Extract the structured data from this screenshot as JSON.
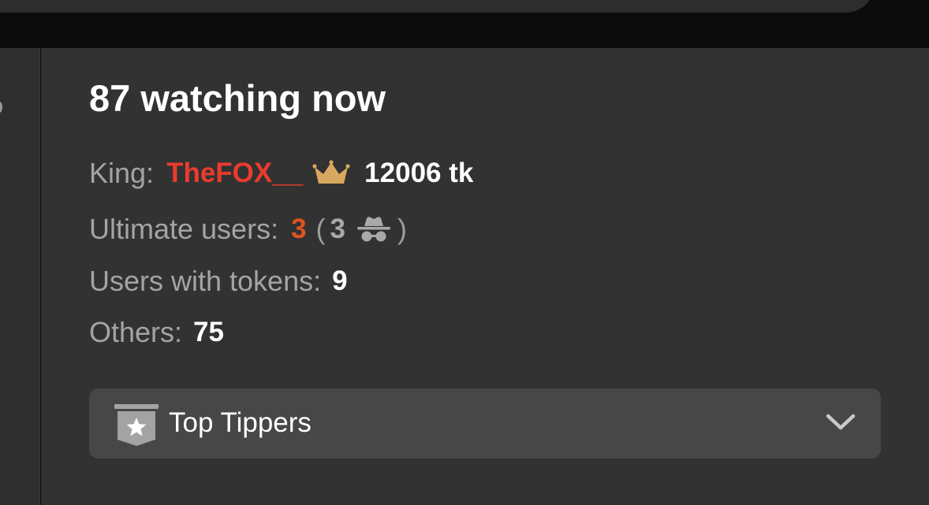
{
  "audience": {
    "headline": "87 watching now",
    "king": {
      "label": "King:",
      "name": "TheFOX__",
      "tokens": "12006 tk",
      "icon": "crown-icon",
      "name_color": "#ea3b2e",
      "icon_color": "#d9a85f"
    },
    "ultimate": {
      "label": "Ultimate users:",
      "count": "3",
      "paren_open": "(",
      "anonymous_count": "3",
      "paren_close": ")",
      "icon": "incognito-icon",
      "count_color": "#e0541f"
    },
    "tokens_users": {
      "label": "Users with tokens:",
      "count": "9"
    },
    "others": {
      "label": "Others:",
      "count": "75"
    }
  },
  "top_tippers": {
    "label": "Top Tippers",
    "icon": "star-badge-icon",
    "toggle_icon": "chevron-down-icon"
  }
}
